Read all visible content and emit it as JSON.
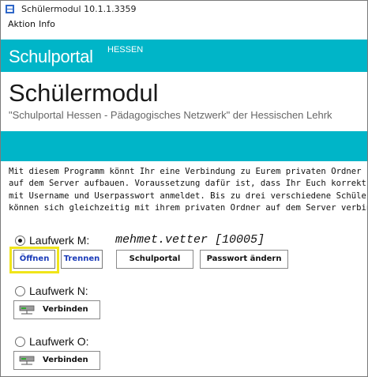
{
  "window": {
    "title": "Schülermodul 10.1.1.3359"
  },
  "menu": {
    "items": [
      "Aktion",
      "Info"
    ]
  },
  "portal": {
    "brand": "Schulportal",
    "region": "HESSEN"
  },
  "main": {
    "heading": "Schülermodul",
    "subheading": "\"Schulportal Hessen - Pädagogisches Netzwerk\" der Hessischen Lehrk",
    "intro": "Mit diesem Programm könnt Ihr eine Verbindung zu Eurem privaten Ordner\nauf dem Server aufbauen. Voraussetzung dafür ist, dass Ihr Euch korrekt\nmit Username und Userpasswort anmeldet. Bis zu drei verschiedene Schüler\nkönnen sich gleichzeitig mit ihrem privaten Ordner auf dem Server verbinden."
  },
  "drives": [
    {
      "label": "Laufwerk M:",
      "selected": true,
      "user": "mehmet.vetter [10005]",
      "buttons": {
        "open": "Öffnen",
        "disconnect": "Trennen",
        "portal": "Schulportal",
        "change_password": "Passwort ändern"
      }
    },
    {
      "label": "Laufwerk N:",
      "selected": false,
      "connect": "Verbinden"
    },
    {
      "label": "Laufwerk O:",
      "selected": false,
      "connect": "Verbinden"
    }
  ],
  "colors": {
    "accent": "#00b5c8",
    "highlight": "#f0e51a",
    "link_blue": "#1a3bb8"
  }
}
